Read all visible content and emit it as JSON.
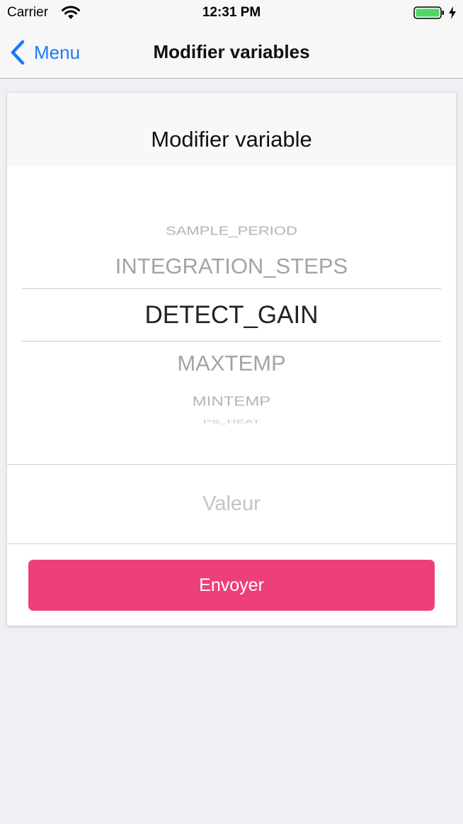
{
  "status_bar": {
    "carrier": "Carrier",
    "time": "12:31 PM",
    "battery_color": "#4cd964"
  },
  "nav": {
    "back_label": "Menu",
    "title": "Modifier variables",
    "accent_color": "#1a7cf5"
  },
  "card": {
    "title": "Modifier variable",
    "picker": {
      "items": [
        "SAMPLE_PERIOD",
        "INTEGRATION_STEPS",
        "DETECT_GAIN",
        "MAXTEMP",
        "MINTEMP",
        "PS_HEAT"
      ],
      "selected": "DETECT_GAIN"
    },
    "value_placeholder": "Valeur",
    "value": "",
    "send_label": "Envoyer",
    "send_color": "#ed407a"
  }
}
